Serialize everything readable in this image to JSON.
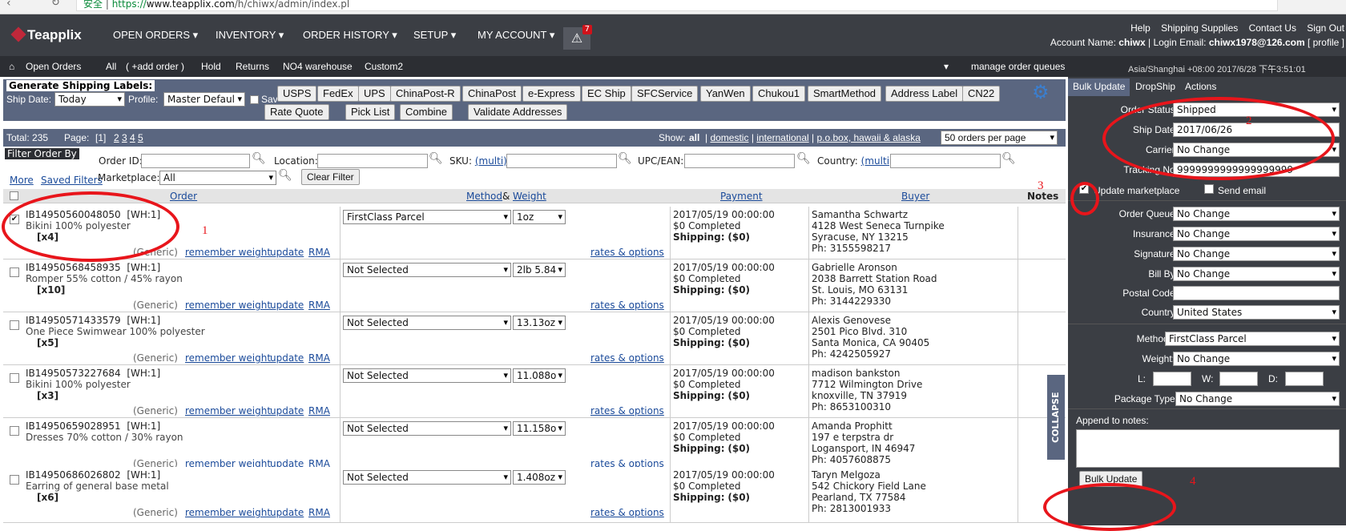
{
  "browser": {
    "secure": "安全",
    "url_prefix": "https://",
    "url_host": "www.teapplix.com",
    "url_path": "/h/chiwx/admin/index.pl"
  },
  "logo": "Teapplix",
  "nav": {
    "menu": [
      "OPEN ORDERS ▾",
      "INVENTORY ▾",
      "ORDER HISTORY ▾",
      "SETUP ▾",
      "MY ACCOUNT ▾"
    ],
    "alert_count": "7",
    "top_links": [
      "Help",
      "Shipping Supplies",
      "Contact Us",
      "Sign Out"
    ],
    "account_label": "Account Name:",
    "account_name": "chiwx",
    "login_label": "Login Email:",
    "login_email": "chiwx1978@126.com",
    "profile": "[ profile ]"
  },
  "subnav": {
    "items": [
      "Open Orders",
      "All",
      "( +add order )",
      "Hold",
      "Returns",
      "NO4 warehouse",
      "Custom2"
    ],
    "manage": "manage order queues",
    "clock": "Asia/Shanghai +08:00 2017/6/28 下午3:51:01"
  },
  "shipping": {
    "title": "Generate Shipping Labels:",
    "ship_date_label": "Ship Date:",
    "ship_date": "Today",
    "profile_label": "Profile:",
    "profile": "Master Defaul",
    "save_label": "Sav",
    "carriers": [
      "USPS",
      "FedEx",
      "UPS",
      "ChinaPost-R",
      "ChinaPost",
      "e-Express",
      "EC Ship",
      "SFCService",
      "YanWen",
      "Chukou1",
      "SmartMethod",
      "Address Label",
      "CN22"
    ],
    "actions": [
      "Rate Quote",
      "Pick List",
      "Combine",
      "Validate Addresses"
    ]
  },
  "summary": {
    "total": "Total: 235",
    "page_label": "Page:",
    "pages": [
      "[1]",
      "2",
      "3",
      "4",
      "5"
    ],
    "show_label": "Show:",
    "show_all": "all",
    "domestic": "domestic",
    "international": "international",
    "pobox": "p.o.box, hawaii & alaska",
    "per_page": "50 orders per page"
  },
  "filter": {
    "title": "Filter Order By",
    "order_id": "Order ID:",
    "location": "Location:",
    "sku": "SKU:",
    "multi": "(multi)",
    "upc": "UPC/EAN:",
    "country": "Country:",
    "more": "More",
    "saved": "Saved Filters",
    "marketplace_label": "Marketplace:",
    "marketplace": "All",
    "clear": "Clear Filter"
  },
  "table": {
    "headers": {
      "order": "Order",
      "method": "Method",
      "amp": "&",
      "weight": "Weight",
      "payment": "Payment",
      "buyer": "Buyer",
      "notes": "Notes"
    },
    "generic": "(Generic)",
    "remember": "remember weight",
    "update": "update",
    "rma": "RMA",
    "rates": "rates & options",
    "shipping_label": "Shipping:",
    "rows": [
      {
        "id": "IB14950560048050",
        "wh": "[WH:1]",
        "desc": "Bikini 100% polyester",
        "qty": "[x4]",
        "method": "FirstClass Parcel",
        "weight": "1oz",
        "date": "2017/05/19 00:00:00",
        "status": "$0 Completed",
        "ship": "($0)",
        "name": "Samantha Schwartz",
        "addr1": "4128 West Seneca Turnpike",
        "addr2": "Syracuse, NY 13215",
        "phone": "Ph: 3155598217",
        "checked": true
      },
      {
        "id": "IB14950568458935",
        "wh": "[WH:1]",
        "desc": "Romper 55% cotton / 45% rayon",
        "qty": "[x10]",
        "method": "Not Selected",
        "weight": "2lb 5.84",
        "date": "2017/05/19 00:00:00",
        "status": "$0 Completed",
        "ship": "($0)",
        "name": "Gabrielle Aronson",
        "addr1": "2038 Barrett Station Road",
        "addr2": "St. Louis, MO 63131",
        "phone": "Ph: 3144229330",
        "checked": false
      },
      {
        "id": "IB14950571433579",
        "wh": "[WH:1]",
        "desc": "One Piece Swimwear 100% polyester",
        "qty": "[x5]",
        "method": "Not Selected",
        "weight": "13.13oz",
        "date": "2017/05/19 00:00:00",
        "status": "$0 Completed",
        "ship": "($0)",
        "name": "Alexis Genovese",
        "addr1": "2501 Pico Blvd. 310",
        "addr2": "Santa Monica, CA 90405",
        "phone": "Ph: 4242505927",
        "checked": false
      },
      {
        "id": "IB14950573227684",
        "wh": "[WH:1]",
        "desc": "Bikini 100% polyester",
        "qty": "[x3]",
        "method": "Not Selected",
        "weight": "11.088o",
        "date": "2017/05/19 00:00:00",
        "status": "$0 Completed",
        "ship": "($0)",
        "name": "madison bankston",
        "addr1": "7712 Wilmington Drive",
        "addr2": "knoxville, TN 37919",
        "phone": "Ph: 8653100310",
        "checked": false
      },
      {
        "id": "IB14950659028951",
        "wh": "[WH:1]",
        "desc": "Dresses 70% cotton / 30% rayon",
        "qty": "",
        "method": "Not Selected",
        "weight": "11.158o",
        "date": "2017/05/19 00:00:00",
        "status": "$0 Completed",
        "ship": "($0)",
        "name": "Amanda Prophitt",
        "addr1": "197 e terpstra dr",
        "addr2": "Logansport, IN 46947",
        "phone": "Ph: 4057608875",
        "checked": false
      },
      {
        "id": "IB14950686026802",
        "wh": "[WH:1]",
        "desc": "Earring of general base metal",
        "qty": "[x6]",
        "method": "Not Selected",
        "weight": "1.408oz",
        "date": "2017/05/19 00:00:00",
        "status": "$0 Completed",
        "ship": "($0)",
        "name": "Taryn Melgoza",
        "addr1": "542 Chickory Field Lane",
        "addr2": "Pearland, TX 77584",
        "phone": "Ph: 2813001933",
        "checked": false
      }
    ]
  },
  "panel": {
    "tabs": [
      "Bulk Update",
      "DropShip",
      "Actions"
    ],
    "order_status_label": "Order Status:",
    "order_status": "Shipped",
    "ship_date_label": "Ship Date:",
    "ship_date": "2017/06/26",
    "carrier_label": "Carrier:",
    "carrier": "No Change",
    "tracking_label": "Tracking No:",
    "tracking": "9999999999999999999",
    "update_marketplace": "Update marketplace",
    "send_email": "Send email",
    "order_queue_label": "Order Queue:",
    "order_queue": "No Change",
    "insurance_label": "Insurance:",
    "insurance": "No Change",
    "signature_label": "Signature:",
    "signature": "No Change",
    "bill_by_label": "Bill By:",
    "bill_by": "No Change",
    "postal_label": "Postal Code:",
    "country_label": "Country:",
    "country": "United States",
    "method_label": "Method:",
    "method": "FirstClass Parcel",
    "weight_label": "Weight:",
    "weight": "No Change",
    "l": "L:",
    "w": "W:",
    "d": "D:",
    "pkg_label": "Package Type:",
    "pkg": "No Change",
    "append_label": "Append to notes:",
    "bulk_button": "Bulk Update",
    "collapse": "COLLAPSE"
  },
  "annotations": [
    "1",
    "2",
    "3",
    "4"
  ]
}
